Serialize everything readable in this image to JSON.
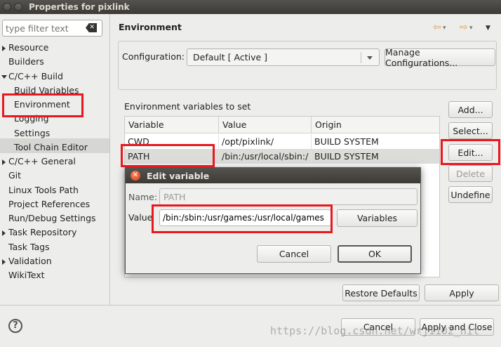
{
  "window": {
    "title": "Properties for pixlink"
  },
  "filter": {
    "placeholder": "type filter text"
  },
  "tree": {
    "items": [
      {
        "label": "Resource",
        "expander": "collapsed"
      },
      {
        "label": "Builders",
        "expander": "none"
      },
      {
        "label": "C/C++ Build",
        "expander": "expanded"
      },
      {
        "label": "Build Variables",
        "expander": "none"
      },
      {
        "label": "Environment",
        "expander": "none",
        "selected": true
      },
      {
        "label": "Logging",
        "expander": "none"
      },
      {
        "label": "Settings",
        "expander": "none"
      },
      {
        "label": "Tool Chain Editor",
        "expander": "none"
      },
      {
        "label": "C/C++ General",
        "expander": "collapsed"
      },
      {
        "label": "Git",
        "expander": "none"
      },
      {
        "label": "Linux Tools Path",
        "expander": "none"
      },
      {
        "label": "Project References",
        "expander": "none"
      },
      {
        "label": "Run/Debug Settings",
        "expander": "none"
      },
      {
        "label": "Task Repository",
        "expander": "collapsed"
      },
      {
        "label": "Task Tags",
        "expander": "none"
      },
      {
        "label": "Validation",
        "expander": "collapsed"
      },
      {
        "label": "WikiText",
        "expander": "none"
      }
    ]
  },
  "page": {
    "title": "Environment",
    "configuration_label": "Configuration:",
    "configuration_value": "Default  [ Active ]",
    "manage_button": "Manage Configurations...",
    "env_label": "Environment variables to set",
    "columns": [
      "Variable",
      "Value",
      "Origin"
    ],
    "rows": [
      {
        "variable": "CWD",
        "value": "/opt/pixlink/",
        "origin": "BUILD SYSTEM"
      },
      {
        "variable": "PATH",
        "value": "/bin:/usr/local/sbin:/",
        "origin": "BUILD SYSTEM",
        "selected": true
      }
    ],
    "buttons": {
      "add": "Add...",
      "select": "Select...",
      "edit": "Edit...",
      "delete": "Delete",
      "undefine": "Undefine"
    },
    "restore_defaults": "Restore Defaults",
    "apply": "Apply"
  },
  "dialog": {
    "title": "Edit variable",
    "name_label": "Name:",
    "name_value": "PATH",
    "value_label": "Value",
    "value_value": "/bin:/sbin:/usr/games:/usr/local/games",
    "variables_button": "Variables",
    "cancel": "Cancel",
    "ok": "OK"
  },
  "footer": {
    "cancel": "Cancel",
    "apply_close": "Apply and Close"
  },
  "watermark": "https://blog.csdn.net/wrj1102_hit",
  "colors": {
    "highlight_box": "#e8181e",
    "title_bar": "#3b3a36",
    "nav_arrow": "#e0a050"
  }
}
